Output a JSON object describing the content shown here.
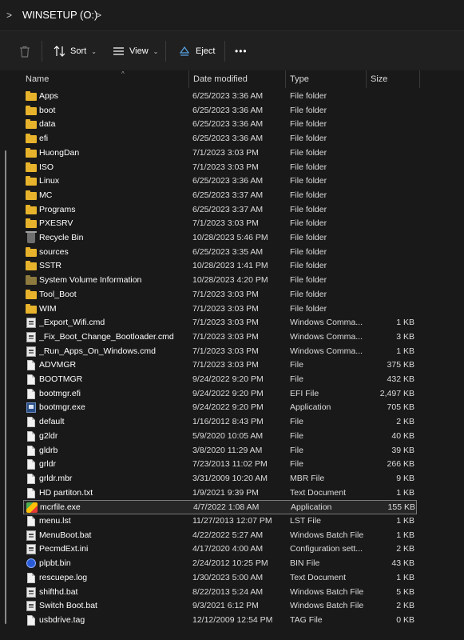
{
  "address": {
    "left_chevron": ">",
    "path": "WINSETUP (O:)",
    "right_chevron": ">"
  },
  "toolbar": {
    "delete_icon": "trash-icon",
    "sort_label": "Sort",
    "view_label": "View",
    "eject_label": "Eject",
    "more_label": "•••",
    "caret": "⌄"
  },
  "columns": {
    "name": "Name",
    "date": "Date modified",
    "type": "Type",
    "size": "Size",
    "sort_indicator": "^"
  },
  "colors": {
    "folder": "#e8b32c",
    "background": "#191919",
    "toolbar": "#202020",
    "selection_border": "#7a7a7a"
  },
  "files": [
    {
      "name": "Apps",
      "date": "6/25/2023 3:36 AM",
      "type": "File folder",
      "size": "",
      "icon": "folder-icon"
    },
    {
      "name": "boot",
      "date": "6/25/2023 3:36 AM",
      "type": "File folder",
      "size": "",
      "icon": "folder-icon"
    },
    {
      "name": "data",
      "date": "6/25/2023 3:36 AM",
      "type": "File folder",
      "size": "",
      "icon": "folder-icon"
    },
    {
      "name": "efi",
      "date": "6/25/2023 3:36 AM",
      "type": "File folder",
      "size": "",
      "icon": "folder-icon"
    },
    {
      "name": "HuongDan",
      "date": "7/1/2023 3:03 PM",
      "type": "File folder",
      "size": "",
      "icon": "folder-icon"
    },
    {
      "name": "ISO",
      "date": "7/1/2023 3:03 PM",
      "type": "File folder",
      "size": "",
      "icon": "folder-icon"
    },
    {
      "name": "Linux",
      "date": "6/25/2023 3:36 AM",
      "type": "File folder",
      "size": "",
      "icon": "folder-icon"
    },
    {
      "name": "MC",
      "date": "6/25/2023 3:37 AM",
      "type": "File folder",
      "size": "",
      "icon": "folder-icon"
    },
    {
      "name": "Programs",
      "date": "6/25/2023 3:37 AM",
      "type": "File folder",
      "size": "",
      "icon": "folder-icon"
    },
    {
      "name": "PXESRV",
      "date": "7/1/2023 3:03 PM",
      "type": "File folder",
      "size": "",
      "icon": "folder-icon"
    },
    {
      "name": "Recycle Bin",
      "date": "10/28/2023 5:46 PM",
      "type": "File folder",
      "size": "",
      "icon": "recycle-bin-icon"
    },
    {
      "name": "sources",
      "date": "6/25/2023 3:35 AM",
      "type": "File folder",
      "size": "",
      "icon": "folder-icon"
    },
    {
      "name": "SSTR",
      "date": "10/28/2023 1:41 PM",
      "type": "File folder",
      "size": "",
      "icon": "folder-icon"
    },
    {
      "name": "System Volume Information",
      "date": "10/28/2023 4:20 PM",
      "type": "File folder",
      "size": "",
      "icon": "system-folder-icon"
    },
    {
      "name": "Tool_Boot",
      "date": "7/1/2023 3:03 PM",
      "type": "File folder",
      "size": "",
      "icon": "folder-icon"
    },
    {
      "name": "WIM",
      "date": "7/1/2023 3:03 PM",
      "type": "File folder",
      "size": "",
      "icon": "folder-icon"
    },
    {
      "name": "_Export_Wifi.cmd",
      "date": "7/1/2023 3:03 PM",
      "type": "Windows Comma...",
      "size": "1 KB",
      "icon": "cmd-file-icon"
    },
    {
      "name": "_Fix_Boot_Change_Bootloader.cmd",
      "date": "7/1/2023 3:03 PM",
      "type": "Windows Comma...",
      "size": "3 KB",
      "icon": "cmd-file-icon"
    },
    {
      "name": "_Run_Apps_On_Windows.cmd",
      "date": "7/1/2023 3:03 PM",
      "type": "Windows Comma...",
      "size": "1 KB",
      "icon": "cmd-file-icon"
    },
    {
      "name": "ADVMGR",
      "date": "7/1/2023 3:03 PM",
      "type": "File",
      "size": "375 KB",
      "icon": "file-icon"
    },
    {
      "name": "BOOTMGR",
      "date": "9/24/2022 9:20 PM",
      "type": "File",
      "size": "432 KB",
      "icon": "file-icon"
    },
    {
      "name": "bootmgr.efi",
      "date": "9/24/2022 9:20 PM",
      "type": "EFI File",
      "size": "2,497 KB",
      "icon": "file-icon"
    },
    {
      "name": "bootmgr.exe",
      "date": "9/24/2022 9:20 PM",
      "type": "Application",
      "size": "705 KB",
      "icon": "application-icon"
    },
    {
      "name": "default",
      "date": "1/16/2012 8:43 PM",
      "type": "File",
      "size": "2 KB",
      "icon": "file-icon"
    },
    {
      "name": "g2ldr",
      "date": "5/9/2020 10:05 AM",
      "type": "File",
      "size": "40 KB",
      "icon": "file-icon"
    },
    {
      "name": "gldrb",
      "date": "3/8/2020 11:29 AM",
      "type": "File",
      "size": "39 KB",
      "icon": "file-icon"
    },
    {
      "name": "grldr",
      "date": "7/23/2013 11:02 PM",
      "type": "File",
      "size": "266 KB",
      "icon": "file-icon"
    },
    {
      "name": "grldr.mbr",
      "date": "3/31/2009 10:20 AM",
      "type": "MBR File",
      "size": "9 KB",
      "icon": "file-icon"
    },
    {
      "name": "HD partiton.txt",
      "date": "1/9/2021 9:39 PM",
      "type": "Text Document",
      "size": "1 KB",
      "icon": "text-file-icon"
    },
    {
      "name": "mcrfile.exe",
      "date": "4/7/2022 1:08 AM",
      "type": "Application",
      "size": "155 KB",
      "icon": "mcr-app-icon",
      "selected": true
    },
    {
      "name": "menu.lst",
      "date": "11/27/2013 12:07 PM",
      "type": "LST File",
      "size": "1 KB",
      "icon": "file-icon"
    },
    {
      "name": "MenuBoot.bat",
      "date": "4/22/2022 5:27 AM",
      "type": "Windows Batch File",
      "size": "1 KB",
      "icon": "cmd-file-icon"
    },
    {
      "name": "PecmdExt.ini",
      "date": "4/17/2020 4:00 AM",
      "type": "Configuration sett...",
      "size": "2 KB",
      "icon": "cmd-file-icon"
    },
    {
      "name": "plpbt.bin",
      "date": "2/24/2012 10:25 PM",
      "type": "BIN File",
      "size": "43 KB",
      "icon": "globe-icon"
    },
    {
      "name": "rescuepe.log",
      "date": "1/30/2023 5:00 AM",
      "type": "Text Document",
      "size": "1 KB",
      "icon": "text-file-icon"
    },
    {
      "name": "shifthd.bat",
      "date": "8/22/2013 5:24 AM",
      "type": "Windows Batch File",
      "size": "5 KB",
      "icon": "cmd-file-icon"
    },
    {
      "name": "Switch Boot.bat",
      "date": "9/3/2021 6:12 PM",
      "type": "Windows Batch File",
      "size": "2 KB",
      "icon": "cmd-file-icon"
    },
    {
      "name": "usbdrive.tag",
      "date": "12/12/2009 12:54 PM",
      "type": "TAG File",
      "size": "0 KB",
      "icon": "file-icon"
    }
  ]
}
